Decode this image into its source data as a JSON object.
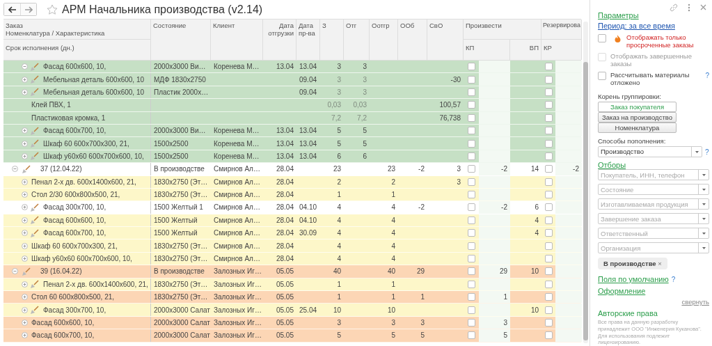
{
  "window": {
    "title": "АРМ Начальника производства (v2.14)"
  },
  "table": {
    "header": {
      "order_labels": [
        "Заказ",
        "Номенклатура / Характеристика"
      ],
      "term_label": "Срок исполнения (дн.)",
      "columns": [
        "Состояние",
        "Клиент",
        "Дата отгрузки",
        "Дата пр-ва",
        "З",
        "Отг",
        "Оотгр",
        "ООб",
        "СвО"
      ],
      "groups": [
        {
          "label": "Произвести",
          "sub": [
            "КП",
            "ВП"
          ]
        },
        {
          "label": "Резервирова",
          "sub": [
            "КР"
          ]
        }
      ]
    },
    "rows": [
      {
        "label": "Фасад 600x600, 10,",
        "kind": "item",
        "expanded": true,
        "icon": true,
        "color": "#c6e0c5",
        "muted": false,
        "kp_checked": false,
        "kr_checked": false,
        "cells": [
          "2000x3000 Ви…",
          "Коренева М…",
          "13.04",
          "13.04",
          "3",
          "3",
          null,
          null,
          null,
          null,
          null,
          null
        ],
        "children": [
          {
            "label": "Мебельная деталь 600x600, 10",
            "kind": "item",
            "expanded": false,
            "icon": true,
            "color": "#c6e0c5",
            "muted": true,
            "kp_checked": false,
            "kr_checked": false,
            "cells": [
              "МДФ 1830x2750",
              null,
              null,
              "09.04",
              "3",
              "3",
              null,
              null,
              "-30",
              null,
              null,
              null
            ]
          },
          {
            "label": "Мебельная деталь 600x600, 10",
            "kind": "item",
            "expanded": false,
            "icon": true,
            "color": "#c6e0c5",
            "muted": true,
            "kp_checked": false,
            "kr_checked": false,
            "cells": [
              "Пластик 2000x…",
              null,
              null,
              "09.04",
              "3",
              "3",
              null,
              null,
              null,
              null,
              null,
              null
            ]
          },
          {
            "label": "Клей ПВХ, 1",
            "kind": "item",
            "icon": false,
            "color": "#c6e0c5",
            "muted": true,
            "kp_checked": false,
            "kr_checked": false,
            "cells": [
              null,
              null,
              null,
              null,
              "0,03",
              "0,03",
              null,
              null,
              "100,57",
              null,
              null,
              null
            ]
          },
          {
            "label": "Пластиковая кромка, 1",
            "kind": "item",
            "icon": false,
            "color": "#c6e0c5",
            "muted": true,
            "kp_checked": false,
            "kr_checked": false,
            "cells": [
              null,
              null,
              null,
              null,
              "7,2",
              "7,2",
              null,
              null,
              "76,738",
              null,
              null,
              null
            ]
          }
        ]
      },
      {
        "label": "Фасад 600x700, 10,",
        "kind": "item",
        "expanded": false,
        "icon": true,
        "color": "#c6e0c5",
        "muted": false,
        "kp_checked": false,
        "kr_checked": false,
        "cells": [
          "2000x3000 Ви…",
          "Коренева М…",
          "13.04",
          "13.04",
          "5",
          "5",
          null,
          null,
          null,
          null,
          null,
          null
        ]
      },
      {
        "label": "Шкаф 60 600x700x300, 21,",
        "kind": "item",
        "expanded": false,
        "icon": true,
        "color": "#c6e0c5",
        "muted": false,
        "kp_checked": false,
        "kr_checked": false,
        "cells": [
          "1500x2500",
          "Коренева М…",
          "13.04",
          "13.04",
          "5",
          "5",
          null,
          null,
          null,
          null,
          null,
          null
        ]
      },
      {
        "label": "Шкаф у60x60 600x700x600, 10,",
        "kind": "item",
        "expanded": false,
        "icon": true,
        "color": "#c6e0c5",
        "muted": false,
        "kp_checked": false,
        "kr_checked": false,
        "cells": [
          "1500x2500",
          "Коренева М…",
          "13.04",
          "13.04",
          "6",
          "6",
          null,
          null,
          null,
          null,
          null,
          null
        ]
      },
      {
        "label": "37 (12.04.22)",
        "kind": "order",
        "expanded": true,
        "icon": true,
        "color": "#ffffff",
        "muted": false,
        "kp_checked": false,
        "kr_checked": false,
        "cells": [
          "В производстве",
          "Смирнов Ал…",
          "28.04",
          null,
          "23",
          null,
          "23",
          "-2",
          "3",
          "-2",
          "14",
          "-2"
        ],
        "children": [
          {
            "label": "Пенал 2-х дв. 600x1400x600, 21,",
            "kind": "item",
            "expanded": false,
            "icon": false,
            "color": "#fdf7c9",
            "muted": false,
            "kp_checked": false,
            "kr_checked": false,
            "cells": [
              "1830x2750 (Эт…",
              "Смирнов Ал…",
              "28.04",
              null,
              "2",
              null,
              "2",
              null,
              "3",
              null,
              null,
              null
            ]
          },
          {
            "label": "Стол 2/30 600x800x500, 21,",
            "kind": "item",
            "expanded": false,
            "icon": false,
            "color": "#fdf7c9",
            "muted": false,
            "kp_checked": false,
            "kr_checked": false,
            "cells": [
              "1830x2750 (Эт…",
              "Смирнов Ал…",
              "28.04",
              null,
              "1",
              null,
              "1",
              null,
              null,
              null,
              null,
              null
            ]
          },
          {
            "label": "Фасад 300x700, 10,",
            "kind": "item",
            "expanded": false,
            "icon": true,
            "color": "#ffffff",
            "muted": false,
            "kp_checked": false,
            "kr_checked": false,
            "cells": [
              "1500 Желтый 1",
              "Смирнов Ал…",
              "28.04",
              "04.10",
              "4",
              null,
              "4",
              "-2",
              null,
              "-2",
              "6",
              null
            ]
          },
          {
            "label": "Фасад 600x600, 10,",
            "kind": "item",
            "expanded": false,
            "icon": true,
            "color": "#fdf7c9",
            "muted": false,
            "kp_checked": false,
            "kr_checked": false,
            "cells": [
              "1500 Желтый",
              "Смирнов Ал…",
              "28.04",
              "04.10",
              "4",
              null,
              "4",
              null,
              null,
              null,
              "4",
              null
            ]
          },
          {
            "label": "Фасад 600x700, 10,",
            "kind": "item",
            "expanded": false,
            "icon": true,
            "color": "#fdf7c9",
            "muted": false,
            "kp_checked": false,
            "kr_checked": false,
            "cells": [
              "1500 Желтый",
              "Смирнов Ал…",
              "28.04",
              "30.09",
              "4",
              null,
              "4",
              null,
              null,
              null,
              "4",
              null
            ]
          },
          {
            "label": "Шкаф 60 600x700x300, 21,",
            "kind": "item",
            "expanded": false,
            "icon": false,
            "color": "#fdf7c9",
            "muted": false,
            "kp_checked": false,
            "kr_checked": false,
            "cells": [
              "1830x2750 (Эт…",
              "Смирнов Ал…",
              "28.04",
              null,
              "4",
              null,
              "4",
              null,
              null,
              null,
              null,
              null
            ]
          },
          {
            "label": "Шкаф у60x60 600x700x600, 10,",
            "kind": "item",
            "expanded": false,
            "icon": false,
            "color": "#fdf7c9",
            "muted": false,
            "kp_checked": false,
            "kr_checked": false,
            "cells": [
              "1830x2750 (Эт…",
              "Смирнов Ал…",
              "28.04",
              null,
              "4",
              null,
              "4",
              null,
              null,
              null,
              null,
              null
            ]
          }
        ]
      },
      {
        "label": "39 (16.04.22)",
        "kind": "order",
        "expanded": true,
        "icon": true,
        "color": "#fcd6b5",
        "muted": false,
        "kp_checked": false,
        "kr_checked": false,
        "cells": [
          "В производстве",
          "Залозных Иг…",
          "05.05",
          null,
          "40",
          null,
          "40",
          "29",
          null,
          "29",
          "10",
          null
        ],
        "children": [
          {
            "label": "Пенал 2-х дв. 600x1400x600, 21,",
            "kind": "item",
            "expanded": false,
            "icon": true,
            "color": "#fdf7c9",
            "muted": false,
            "kp_checked": false,
            "kr_checked": false,
            "cells": [
              "1830x2750 (Эт…",
              "Залозных Иг…",
              "05.05",
              null,
              "1",
              null,
              "1",
              null,
              null,
              null,
              null,
              null
            ]
          },
          {
            "label": "Стол 60 600x800x500, 21,",
            "kind": "item",
            "expanded": false,
            "icon": false,
            "color": "#fcd6b5",
            "muted": false,
            "kp_checked": false,
            "kr_checked": false,
            "cells": [
              "1830x2750 (Эт…",
              "Залозных Иг…",
              "05.05",
              null,
              "1",
              null,
              "1",
              "1",
              null,
              "1",
              null,
              null
            ]
          },
          {
            "label": "Фасад 300x700, 10,",
            "kind": "item",
            "expanded": false,
            "icon": true,
            "color": "#fdf7c9",
            "muted": false,
            "kp_checked": false,
            "kr_checked": false,
            "cells": [
              "2000x3000 Салат",
              "Залозных Иг…",
              "05.05",
              "25.04",
              "10",
              null,
              "10",
              null,
              null,
              null,
              "10",
              null
            ]
          },
          {
            "label": "Фасад 600x600, 10,",
            "kind": "item",
            "expanded": false,
            "icon": false,
            "color": "#fcd6b5",
            "muted": false,
            "kp_checked": false,
            "kr_checked": false,
            "cells": [
              "2000x3000 Салат",
              "Залозных Иг…",
              "05.05",
              null,
              "3",
              null,
              "3",
              "3",
              null,
              "3",
              null,
              null
            ]
          },
          {
            "label": "Фасад 600x700, 10,",
            "kind": "item",
            "expanded": false,
            "icon": false,
            "color": "#fcd6b5",
            "muted": false,
            "kp_checked": false,
            "kr_checked": false,
            "cells": [
              "2000x3000 Салат",
              "Залозных Иг…",
              "05.05",
              null,
              "5",
              null,
              "5",
              "5",
              null,
              "5",
              null,
              null
            ]
          }
        ]
      }
    ]
  },
  "panel": {
    "heading": "Параметры",
    "period_link": "Период: за все время",
    "options": [
      {
        "label": "Отображать только просроченные заказы",
        "kind": "alert",
        "checked": false,
        "disabled": false
      },
      {
        "label": "Отображать завершенные заказы",
        "kind": "plain",
        "checked": false,
        "disabled": true
      },
      {
        "label": "Рассчитывать материалы отложено",
        "kind": "plain",
        "checked": false,
        "disabled": false,
        "help": "?"
      }
    ],
    "grouping": {
      "label": "Корень группировки:",
      "buttons": [
        {
          "label": "Заказ покупателя",
          "selected": true
        },
        {
          "label": "Заказ на производство",
          "selected": false
        },
        {
          "label": "Номенклатура",
          "selected": false
        }
      ]
    },
    "replenishment": {
      "label": "Способы пополнения:",
      "value": "Производство",
      "help": "?"
    },
    "filters": {
      "title": "Отборы",
      "fields": [
        {
          "placeholder": "Покупатель, ИНН, телефон"
        },
        {
          "placeholder": "Состояние"
        },
        {
          "placeholder": "Изготавливаемая продукция"
        },
        {
          "placeholder": "Завершение заказа"
        },
        {
          "placeholder": "Ответственный"
        },
        {
          "placeholder": "Организация"
        }
      ]
    },
    "chip": {
      "label": "В производстве",
      "remove": "×"
    },
    "defaults_link": "Поля по умолчанию",
    "defaults_help": "?",
    "design_link": "Оформление",
    "collapse_link": "свернуть",
    "copyright": {
      "title": "Авторские права",
      "text": "Все права на данную разработку принадлежит ООО \"Инженерия Куканова\". Для использования подлежит лицензированию."
    }
  }
}
